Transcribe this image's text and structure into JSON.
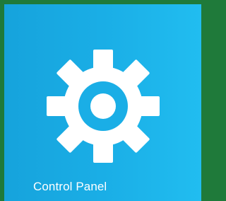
{
  "tile": {
    "label": "Control Panel",
    "icon": "gear-icon",
    "background_color": "#1aaee6",
    "frame_color": "#1f7a3a",
    "icon_color": "#ffffff"
  }
}
